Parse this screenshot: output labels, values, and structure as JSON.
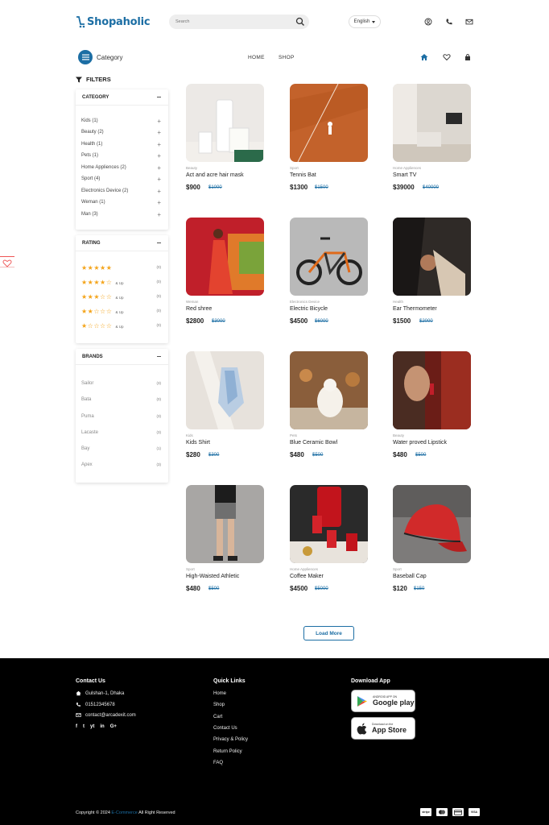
{
  "colors": {
    "accent": "#1c6ea4",
    "star": "#f4a41a",
    "footer_bg": "#000000"
  },
  "header": {
    "logo_text": "Shopaholic",
    "search_placeholder": "Search",
    "language": "English",
    "icons": [
      "user-icon",
      "phone-icon",
      "mail-icon"
    ]
  },
  "nav": {
    "category_label": "Category",
    "links": [
      "HOME",
      "SHOP"
    ],
    "icons": [
      "home-icon",
      "heart-icon",
      "bag-icon"
    ]
  },
  "filters": {
    "title": "FILTERS",
    "category": {
      "heading": "CATEGORY",
      "items": [
        "Kids (1)",
        "Beauty (2)",
        "Health (1)",
        "Pets (1)",
        "Home Appliences (2)",
        "Sport (4)",
        "Electronics Device (2)",
        "Weman (1)",
        "Man (3)"
      ]
    },
    "rating": {
      "heading": "RATING",
      "rows": [
        {
          "stars": 5,
          "suffix": "",
          "count": "(0)"
        },
        {
          "stars": 4,
          "suffix": "& Up",
          "count": "(0)"
        },
        {
          "stars": 3,
          "suffix": "& Up",
          "count": "(0)"
        },
        {
          "stars": 2,
          "suffix": "& Up",
          "count": "(0)"
        },
        {
          "stars": 1,
          "suffix": "& Up",
          "count": "(0)"
        }
      ]
    },
    "brands": {
      "heading": "BRANDS",
      "items": [
        {
          "name": "Sailor",
          "count": "(3)"
        },
        {
          "name": "Bata",
          "count": "(0)"
        },
        {
          "name": "Puma",
          "count": "(3)"
        },
        {
          "name": "Lacaste",
          "count": "(3)"
        },
        {
          "name": "Bay",
          "count": "(1)"
        },
        {
          "name": "Apex",
          "count": "(3)"
        }
      ]
    }
  },
  "products": [
    {
      "category": "Beauty",
      "name": "Act and acre hair mask",
      "price": "$900",
      "old_price": "$1000",
      "image": "hair-mask-tubes"
    },
    {
      "category": "Sport",
      "name": "Tennis Bat",
      "price": "$1300",
      "old_price": "$1500",
      "image": "clay-tennis-court"
    },
    {
      "category": "Home Appliences",
      "name": "Smart TV",
      "price": "$39000",
      "old_price": "$40000",
      "image": "living-room-tv"
    },
    {
      "category": "Weman",
      "name": "Red shree",
      "price": "$2800",
      "old_price": "$3000",
      "image": "red-saree"
    },
    {
      "category": "Electronics Device",
      "name": "Electric Bicycle",
      "price": "$4500",
      "old_price": "$6000",
      "image": "e-bike"
    },
    {
      "category": "Health",
      "name": "Ear Thermometer",
      "price": "$1500",
      "old_price": "$2000",
      "image": "ear-check"
    },
    {
      "category": "Kids",
      "name": "Kids Shirt",
      "price": "$280",
      "old_price": "$300",
      "image": "hanging-shirt"
    },
    {
      "category": "Pets",
      "name": "Blue Ceramic Bowl",
      "price": "$480",
      "old_price": "$500",
      "image": "white-dog"
    },
    {
      "category": "Beauty",
      "name": "Water proved Lipstick",
      "price": "$480",
      "old_price": "$500",
      "image": "lipstick"
    },
    {
      "category": "Sport",
      "name": "High-Waisted Athletic",
      "price": "$480",
      "old_price": "$500",
      "image": "athletic-shorts"
    },
    {
      "category": "Home Appliences",
      "name": "Coffee Maker",
      "price": "$4500",
      "old_price": "$5000",
      "image": "red-coffee-maker"
    },
    {
      "category": "Sport",
      "name": "Baseball Cap",
      "price": "$120",
      "old_price": "$150",
      "image": "red-cap"
    }
  ],
  "load_more": "Load More",
  "footer": {
    "contact": {
      "heading": "Contact Us",
      "address": "Gulshan-1, Dhaka",
      "phone": "01512345678",
      "email": "contact@arcadexit.com",
      "social": [
        "f",
        "t",
        "yt",
        "in",
        "G+"
      ]
    },
    "quick_links": {
      "heading": "Quick Links",
      "items": [
        "Home",
        "Shop",
        "Cart",
        "Contact Us",
        "Privacy & Policy",
        "Return Policy",
        "FAQ"
      ]
    },
    "download": {
      "heading": "Download App",
      "google_small": "ANDROID APP ON",
      "google_big": "Google play",
      "apple_small": "Download on the",
      "apple_big": "App Store"
    },
    "copyright_prefix": "Copyright © 2024",
    "copyright_accent": "E-Commerce",
    "copyright_suffix": "All Right Reserved",
    "payments": [
      "stripe",
      "mastercard",
      "card",
      "VISA"
    ]
  }
}
